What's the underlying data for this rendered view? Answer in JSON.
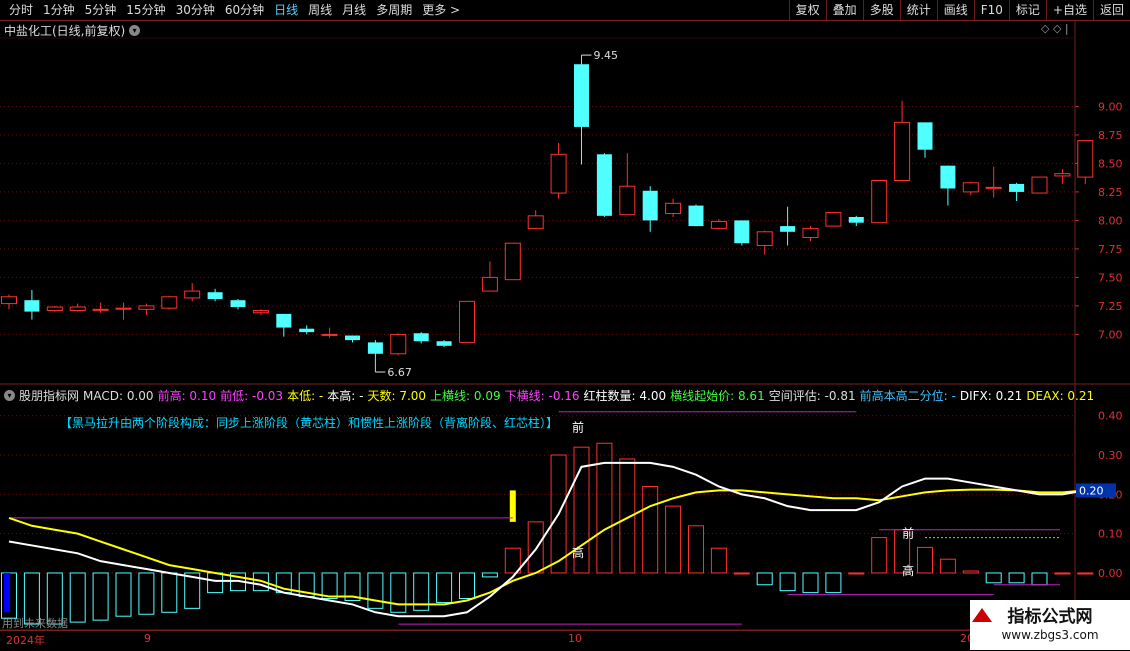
{
  "toolbar": {
    "periods": [
      "分时",
      "1分钟",
      "5分钟",
      "15分钟",
      "30分钟",
      "60分钟",
      "日线",
      "周线",
      "月线",
      "多周期",
      "更多 >"
    ],
    "active_index": 6,
    "right_buttons": [
      "复权",
      "叠加",
      "多股",
      "统计",
      "画线",
      "F10",
      "标记",
      "+自选",
      "返回"
    ]
  },
  "stock": {
    "title": "中盐化工(日线,前复权)",
    "icon": "chevron-down-icon"
  },
  "top_right": "◇ ◇ |",
  "price_axis": [
    "9.00",
    "8.75",
    "8.50",
    "8.25",
    "8.00",
    "7.75",
    "7.50",
    "7.25",
    "7.00"
  ],
  "price_annotations": {
    "high": "9.45",
    "low": "6.67"
  },
  "indicator": {
    "name": "股朋指标网",
    "fields": [
      {
        "text": "MACD: 0.00",
        "color": "#dddddd"
      },
      {
        "text": "前高: 0.10",
        "color": "#ff40ff"
      },
      {
        "text": "前低: -0.03",
        "color": "#ff40ff"
      },
      {
        "text": "本低: -",
        "color": "#ffff00"
      },
      {
        "text": "本高: -",
        "color": "#ffffff"
      },
      {
        "text": "天数: 7.00",
        "color": "#ffff00"
      },
      {
        "text": "上横线: 0.09",
        "color": "#40ff40"
      },
      {
        "text": "下横线: -0.16",
        "color": "#ff40ff"
      },
      {
        "text": "红柱数量: 4.00",
        "color": "#ffffff"
      },
      {
        "text": "横线起始价: 8.61",
        "color": "#40ff40"
      },
      {
        "text": "空间评估: -0.81",
        "color": "#dddddd"
      },
      {
        "text": "前高本高二分位: -",
        "color": "#40c0ff"
      },
      {
        "text": "DIFX: 0.21",
        "color": "#ffffff"
      },
      {
        "text": "DEAX: 0.21",
        "color": "#ffff00"
      }
    ],
    "banner": "【黑马拉升由两个阶段构成：同步上涨阶段（黄芯柱）和惯性上涨阶段（背离阶段、红芯柱）】",
    "axis": [
      "0.40",
      "0.30",
      "0.20",
      "0.10",
      "0.00"
    ],
    "current_value": "0.20",
    "labels": {
      "qian1": "前",
      "gao1": "高",
      "qian2": "前",
      "gao2": "高"
    }
  },
  "date_axis": {
    "year": "2024年",
    "m9": "9",
    "m10": "10",
    "m11": "20"
  },
  "future_note": "用到未来数据",
  "watermark": {
    "title": "指标公式网",
    "url": "www.zbgs3.com"
  },
  "chart_data": {
    "type": "candlestick",
    "candles": [
      [
        7.27,
        7.33,
        7.22,
        7.35
      ],
      [
        7.3,
        7.2,
        7.13,
        7.39
      ],
      [
        7.21,
        7.24,
        7.2,
        7.25
      ],
      [
        7.21,
        7.24,
        7.2,
        7.27
      ],
      [
        7.22,
        7.22,
        7.19,
        7.28
      ],
      [
        7.23,
        7.23,
        7.13,
        7.28
      ],
      [
        7.22,
        7.25,
        7.17,
        7.27
      ],
      [
        7.23,
        7.33,
        7.22,
        7.34
      ],
      [
        7.32,
        7.38,
        7.29,
        7.45
      ],
      [
        7.37,
        7.31,
        7.29,
        7.4
      ],
      [
        7.3,
        7.24,
        7.22,
        7.31
      ],
      [
        7.19,
        7.21,
        7.17,
        7.22
      ],
      [
        7.18,
        7.06,
        6.98,
        7.18
      ],
      [
        7.05,
        7.02,
        7.0,
        7.08
      ],
      [
        7.0,
        7.0,
        6.97,
        7.06
      ],
      [
        6.99,
        6.95,
        6.93,
        6.99
      ],
      [
        6.93,
        6.83,
        6.67,
        6.95
      ],
      [
        6.83,
        7.0,
        6.82,
        7.01
      ],
      [
        7.01,
        6.94,
        6.92,
        7.02
      ],
      [
        6.94,
        6.9,
        6.89,
        6.95
      ],
      [
        6.93,
        7.29,
        6.93,
        7.29
      ],
      [
        7.38,
        7.5,
        7.38,
        7.64
      ],
      [
        7.48,
        7.8,
        7.48,
        7.8
      ],
      [
        7.93,
        8.04,
        7.93,
        8.09
      ],
      [
        8.24,
        8.58,
        8.19,
        8.68
      ],
      [
        9.37,
        8.82,
        8.49,
        9.45
      ],
      [
        8.58,
        8.04,
        8.03,
        8.59
      ],
      [
        8.05,
        8.3,
        8.05,
        8.59
      ],
      [
        8.26,
        8.0,
        7.9,
        8.3
      ],
      [
        8.06,
        8.15,
        8.03,
        8.19
      ],
      [
        8.13,
        7.95,
        7.95,
        8.14
      ],
      [
        7.93,
        7.99,
        7.92,
        8.01
      ],
      [
        8.0,
        7.8,
        7.78,
        8.0
      ],
      [
        7.78,
        7.9,
        7.7,
        7.91
      ],
      [
        7.95,
        7.9,
        7.78,
        8.12
      ],
      [
        7.85,
        7.93,
        7.82,
        7.95
      ],
      [
        7.95,
        8.07,
        7.95,
        8.07
      ],
      [
        8.03,
        7.98,
        7.95,
        8.04
      ],
      [
        7.98,
        8.35,
        7.98,
        8.35
      ],
      [
        8.35,
        8.86,
        8.35,
        9.05
      ],
      [
        8.86,
        8.62,
        8.55,
        8.86
      ],
      [
        8.48,
        8.28,
        8.13,
        8.48
      ],
      [
        8.25,
        8.33,
        8.22,
        8.34
      ],
      [
        8.29,
        8.29,
        8.2,
        8.47
      ],
      [
        8.32,
        8.25,
        8.17,
        8.33
      ],
      [
        8.24,
        8.38,
        8.24,
        8.38
      ],
      [
        8.39,
        8.41,
        8.32,
        8.45
      ],
      [
        8.38,
        8.7,
        8.32,
        8.7
      ]
    ],
    "y_range": [
      6.6,
      9.6
    ],
    "macd": {
      "bars": [
        -0.115,
        -0.13,
        -0.13,
        -0.125,
        -0.12,
        -0.11,
        -0.105,
        -0.1,
        -0.09,
        -0.05,
        -0.045,
        -0.045,
        -0.05,
        -0.06,
        -0.065,
        -0.07,
        -0.09,
        -0.1,
        -0.095,
        -0.075,
        -0.065,
        -0.01,
        0.063,
        0.13,
        0.3,
        0.32,
        0.33,
        0.29,
        0.22,
        0.17,
        0.12,
        0.063,
        0.0,
        -0.03,
        -0.045,
        -0.05,
        -0.05,
        0.0,
        0.09,
        0.11,
        0.065,
        0.035,
        0.005,
        -0.025,
        -0.025,
        -0.03,
        0.0,
        0.0
      ],
      "dif": [
        0.08,
        0.07,
        0.06,
        0.05,
        0.03,
        0.02,
        0.01,
        0.0,
        -0.01,
        -0.02,
        -0.02,
        -0.03,
        -0.05,
        -0.06,
        -0.07,
        -0.08,
        -0.1,
        -0.11,
        -0.11,
        -0.11,
        -0.1,
        -0.06,
        -0.01,
        0.06,
        0.15,
        0.27,
        0.28,
        0.28,
        0.28,
        0.27,
        0.25,
        0.22,
        0.2,
        0.19,
        0.17,
        0.16,
        0.16,
        0.16,
        0.18,
        0.22,
        0.24,
        0.24,
        0.23,
        0.22,
        0.21,
        0.2,
        0.2,
        0.21
      ],
      "dea": [
        0.14,
        0.12,
        0.11,
        0.1,
        0.08,
        0.06,
        0.04,
        0.02,
        0.01,
        0.0,
        -0.01,
        -0.02,
        -0.04,
        -0.05,
        -0.06,
        -0.06,
        -0.07,
        -0.08,
        -0.08,
        -0.08,
        -0.07,
        -0.05,
        -0.02,
        0.0,
        0.03,
        0.07,
        0.11,
        0.14,
        0.17,
        0.19,
        0.205,
        0.21,
        0.21,
        0.205,
        0.2,
        0.195,
        0.19,
        0.19,
        0.185,
        0.195,
        0.205,
        0.21,
        0.212,
        0.212,
        0.21,
        0.205,
        0.205,
        0.21
      ],
      "y_range": [
        -0.14,
        0.44
      ]
    }
  }
}
